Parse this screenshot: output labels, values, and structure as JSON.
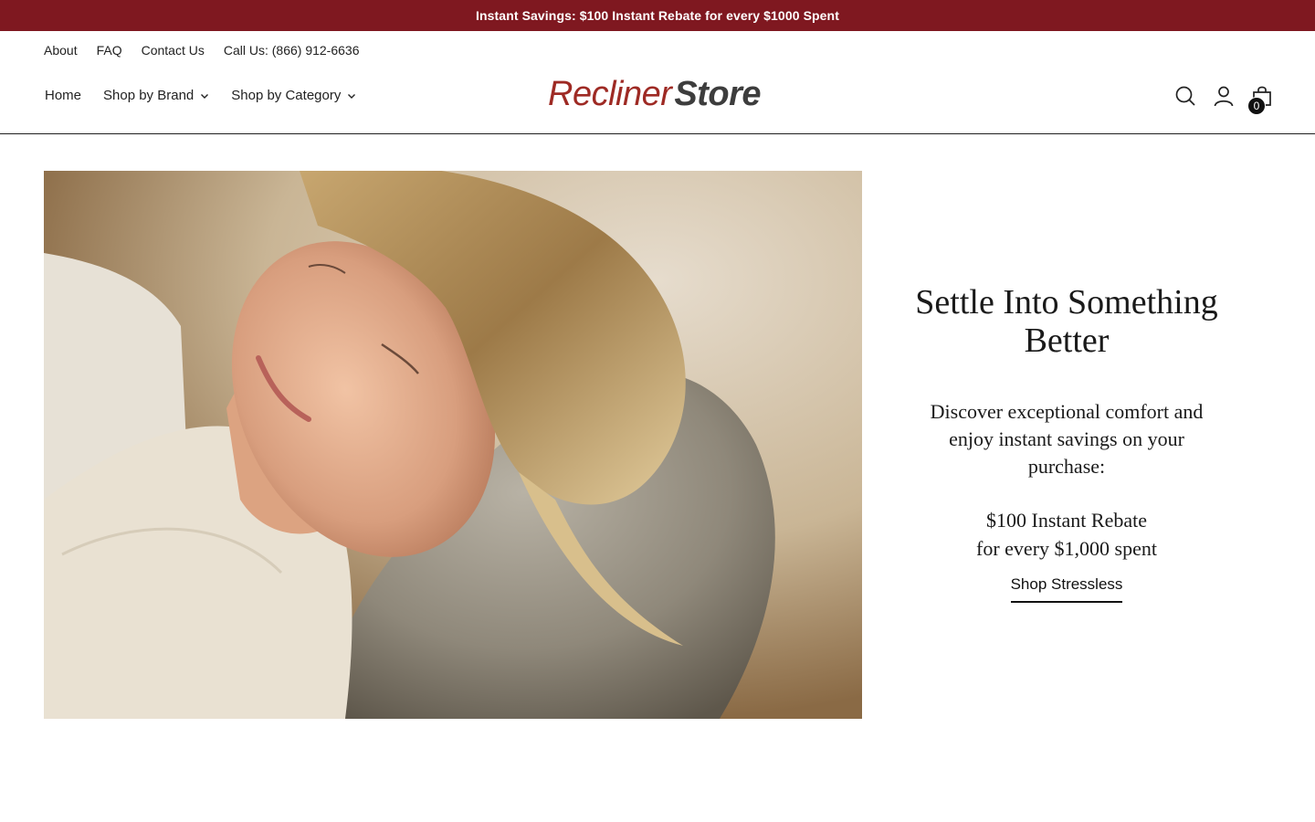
{
  "announcement": {
    "text": "Instant Savings: $100 Instant Rebate for every $1000 Spent"
  },
  "util_links": [
    "About",
    "FAQ",
    "Contact Us",
    "Call Us: (866) 912-6636"
  ],
  "main_nav": [
    {
      "label": "Home",
      "has_dropdown": false
    },
    {
      "label": "Shop by Brand",
      "has_dropdown": true
    },
    {
      "label": "Shop by Category",
      "has_dropdown": true
    }
  ],
  "logo": {
    "part1": "Recliner",
    "part2": "Store"
  },
  "header_icons": [
    "search-icon",
    "account-icon",
    "cart-icon"
  ],
  "cart": {
    "count": "0"
  },
  "hero": {
    "title": "Settle Into Something Better",
    "description": "Discover exceptional comfort and enjoy instant savings on your purchase:",
    "offer_line1": "$100 Instant Rebate",
    "offer_line2": "for every $1,000 spent",
    "cta": "Shop Stressless"
  },
  "colors": {
    "announcement_bg": "#7f1820",
    "logo_red": "#9e2a24",
    "logo_dark": "#3d3d3d"
  }
}
